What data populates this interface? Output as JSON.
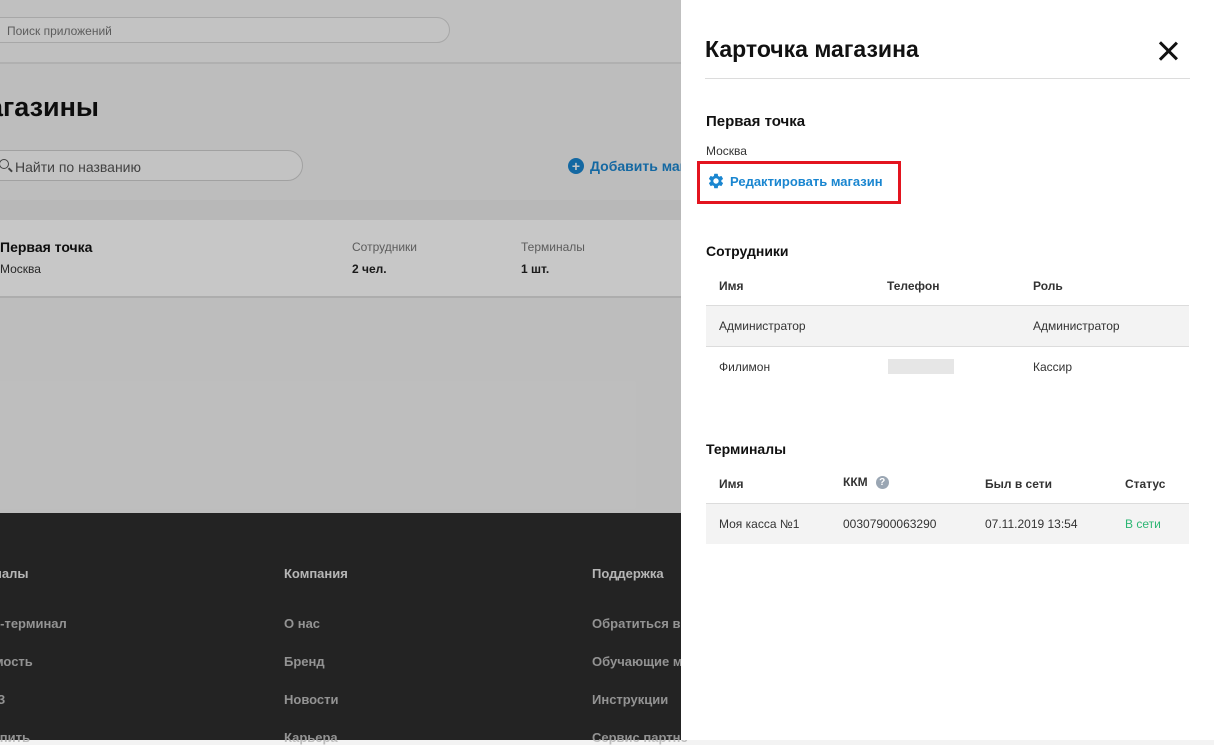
{
  "header": {
    "app_search_placeholder": "Поиск приложений"
  },
  "page": {
    "title": "агазины",
    "search_placeholder": "Найти по названию",
    "add_store_label": "Добавить мага"
  },
  "store_card": {
    "name": "Первая точка",
    "city": "Москва",
    "employees_label": "Сотрудники",
    "employees_value": "2 чел.",
    "terminals_label": "Терминалы",
    "terminals_value": "1 шт."
  },
  "footer": {
    "columns": [
      {
        "heading": "иналы",
        "links": [
          "рт-терминал",
          "имость",
          "ФЗ",
          "купить"
        ]
      },
      {
        "heading": "Компания",
        "links": [
          "О нас",
          "Бренд",
          "Новости",
          "Карьера"
        ]
      },
      {
        "heading": "Поддержка",
        "links": [
          "Обратиться в",
          "Обучающие м",
          "Инструкции",
          "Сервис партне"
        ]
      }
    ]
  },
  "drawer": {
    "title": "Карточка магазина",
    "close_icon": "close-icon",
    "store_name": "Первая точка",
    "store_city": "Москва",
    "edit_label": "Редактировать магазин",
    "edit_icon": "gear-icon",
    "highlight_color": "#e3141f",
    "accent_color": "#1a86d0",
    "employees": {
      "title": "Сотрудники",
      "headers": [
        "Имя",
        "Телефон",
        "Роль"
      ],
      "rows": [
        {
          "name": "Администратор",
          "phone": "",
          "role": "Администратор"
        },
        {
          "name": "Филимон",
          "phone": "",
          "role": "Кассир"
        }
      ]
    },
    "terminals": {
      "title": "Терминалы",
      "headers": [
        "Имя",
        "ККМ",
        "Был в сети",
        "Статус"
      ],
      "rows": [
        {
          "name": "Моя касса №1",
          "kkm": "00307900063290",
          "last_seen": "07.11.2019 13:54",
          "status": "В сети"
        }
      ],
      "help_glyph": "?",
      "status_color": "#2bb673"
    }
  }
}
